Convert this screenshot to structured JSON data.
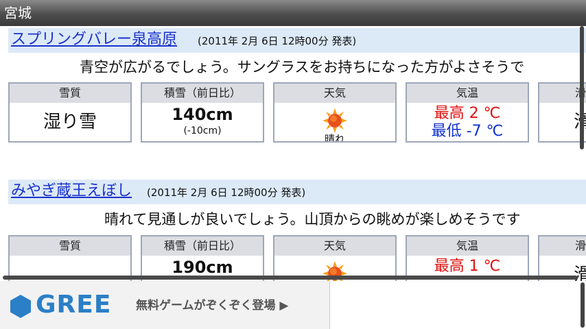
{
  "window": {
    "title": "宮城"
  },
  "resorts": [
    {
      "name": "スプリングバレー泉高原",
      "date": "(2011年 2月 6日 12時00分 発表)",
      "comment": "青空が広がるでしょう。サングラスをお持ちになった方がよさそうで",
      "cells": {
        "quality_label": "雪質",
        "quality_value": "湿り雪",
        "snow_label": "積雪（前日比）",
        "snow_value": "140cm",
        "snow_diff": "(-10cm)",
        "weather_label": "天気",
        "weather_value": "晴れ",
        "weather_icon": "sun-icon",
        "temp_label": "気温",
        "temp_high": "最高 2 ℃",
        "temp_low": "最低 -7 ℃",
        "extra_label": "滑",
        "extra_value": "滑"
      }
    },
    {
      "name": "みやぎ蔵王えぼし",
      "date": "(2011年 2月 6日 12時00分 発表)",
      "comment": "晴れて見通しが良いでしょう。山頂からの眺めが楽しめそうです",
      "cells": {
        "quality_label": "雪質",
        "snow_label": "積雪（前日比）",
        "snow_value": "190cm",
        "weather_label": "天気",
        "weather_icon": "sun-icon",
        "temp_label": "気温",
        "temp_high": "最高 1 ℃",
        "extra_label": "滑",
        "extra_value": "滑"
      }
    }
  ],
  "ad": {
    "brand": "GREE",
    "text": "無料ゲームがぞくぞく登場 ▶",
    "brand_color": "#2b7fc7"
  },
  "colors": {
    "header_bg": "#dce9f7",
    "link": "#1a33cc",
    "temp_high": "#e01010",
    "temp_low": "#1030d0"
  }
}
